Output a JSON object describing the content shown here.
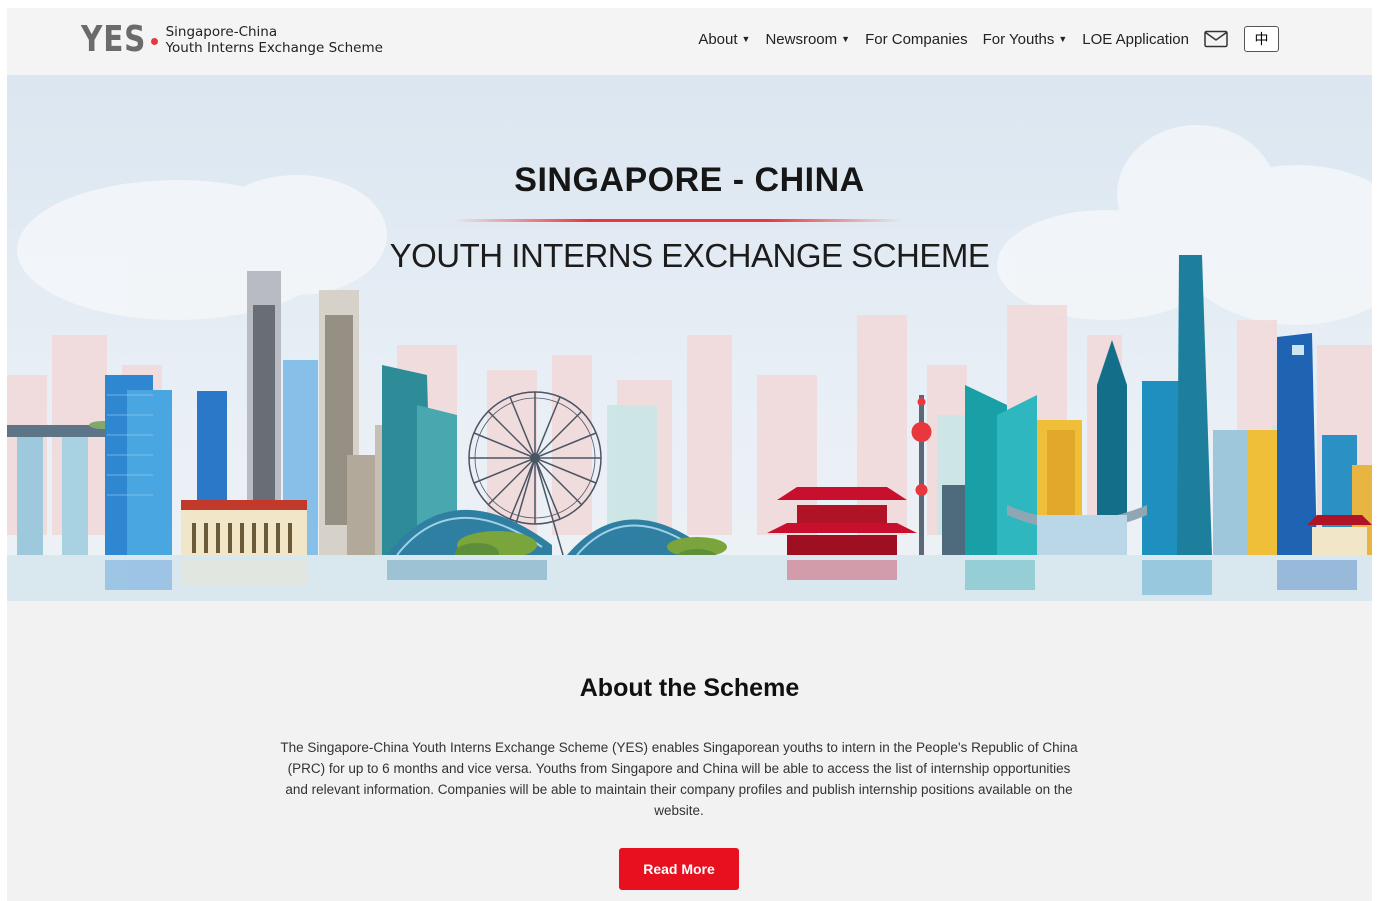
{
  "header": {
    "logo_mark": "YES",
    "logo_line1": "Singapore-China",
    "logo_line2": "Youth Interns Exchange Scheme",
    "nav": [
      {
        "label": "About",
        "dropdown": true
      },
      {
        "label": "Newsroom",
        "dropdown": true
      },
      {
        "label": "For Companies",
        "dropdown": false
      },
      {
        "label": "For Youths",
        "dropdown": true
      },
      {
        "label": "LOE Application",
        "dropdown": false
      }
    ],
    "mail_icon": "envelope-icon",
    "lang_label": "中"
  },
  "hero": {
    "title": "SINGAPORE - CHINA",
    "subtitle": "YOUTH INTERNS EXCHANGE SCHEME"
  },
  "about": {
    "heading": "About the Scheme",
    "body": "The Singapore-China Youth Interns Exchange Scheme (YES) enables Singaporean youths to intern in the People's Republic of China (PRC) for up to 6 months and vice versa. Youths from Singapore and China will be able to access the list of internship opportunities and relevant information. Companies will be able to maintain their company profiles and publish internship positions available on the website.",
    "button": "Read More"
  },
  "colors": {
    "accent": "#e8101e",
    "logo_dot": "#e8383d",
    "page_bg": "#f2f2f2"
  }
}
